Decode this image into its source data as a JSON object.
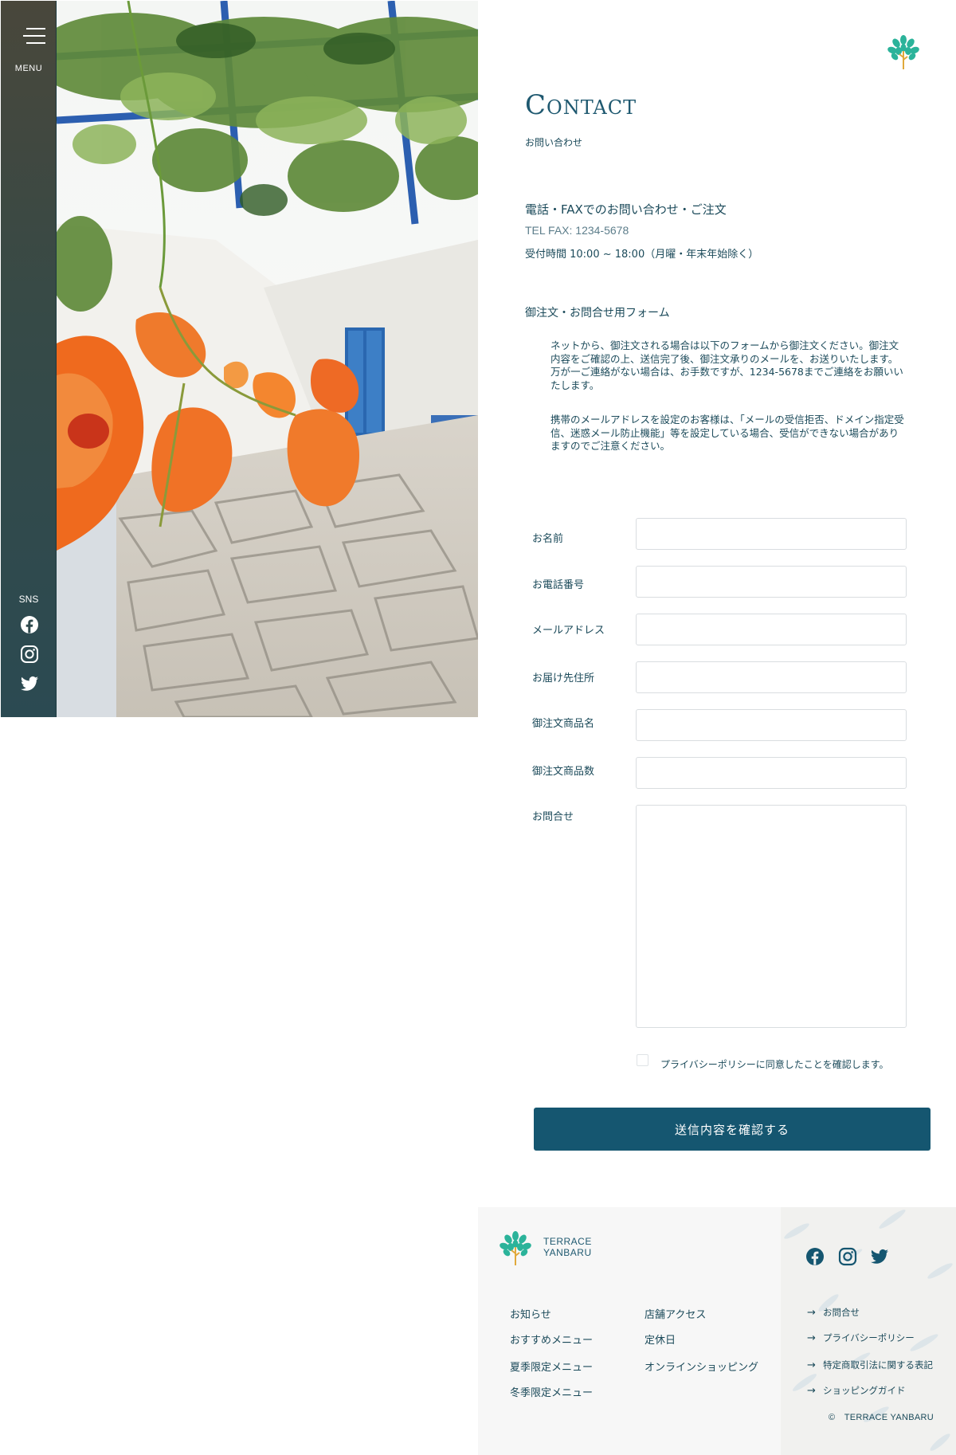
{
  "sidebar": {
    "menu_label": "MENU",
    "sns_label": "SNS"
  },
  "header": {
    "title": "Contact",
    "subtitle": "お問い合わせ"
  },
  "phone_section": {
    "heading": "電話・FAXでのお問い合わせ・ご注文",
    "number": "TEL FAX: 1234-5678",
    "hours": "受付時間 10:00 ~ 18:00（月曜・年末年始除く）"
  },
  "form_section": {
    "heading": "御注文・お問合せ用フォーム",
    "notes": [
      "ネットから、御注文される場合は以下のフォームから御注文ください。御注文内容をご確認の上、送信完了後、御注文承りのメールを、お送りいたします。万が一ご連絡がない場合は、お手数ですが、1234-5678までご連絡をお願いいたします。",
      "携帯のメールアドレスを設定のお客様は、「メールの受信拒否、ドメイン指定受信、迷惑メール防止機能」等を設定している場合、受信ができない場合がありますのでご注意ください。"
    ]
  },
  "form": {
    "fields": [
      {
        "label": "お名前",
        "value": ""
      },
      {
        "label": "お電話番号",
        "value": ""
      },
      {
        "label": "メールアドレス",
        "value": ""
      },
      {
        "label": "お届け先住所",
        "value": ""
      },
      {
        "label": "御注文商品名",
        "value": ""
      },
      {
        "label": "御注文商品数",
        "value": ""
      },
      {
        "label": "お問合せ",
        "value": ""
      }
    ],
    "privacy_label": "プライバシーポリシーに同意したことを確認します。",
    "privacy_checked": false,
    "submit_label": "送信内容を確認する"
  },
  "footer": {
    "brand_line1": "TERRACE",
    "brand_line2": "YANBARU",
    "nav_col1": [
      "お知らせ",
      "おすすめメニュー",
      "夏季限定メニュー",
      "冬季限定メニュー"
    ],
    "nav_col2": [
      "店舗アクセス",
      "定休日",
      "オンラインショッピング"
    ],
    "sub_links": [
      "お問合せ",
      "プライバシーポリシー",
      "特定商取引法に関する表記",
      "ショッピングガイド"
    ],
    "arrow": "→",
    "copyright": "©　TERRACE YANBARU"
  },
  "icons": {
    "menu": "hamburger-icon",
    "sns": [
      "facebook-icon",
      "instagram-icon",
      "twitter-icon"
    ],
    "logo": "tree-logo-icon"
  },
  "colors": {
    "primary": "#155670",
    "text": "#1b4a5a",
    "sidebar_top": "#49473b",
    "sidebar_bottom": "#2b4a52",
    "logo_green": "#2bb39a",
    "logo_trunk": "#e0a93b"
  }
}
